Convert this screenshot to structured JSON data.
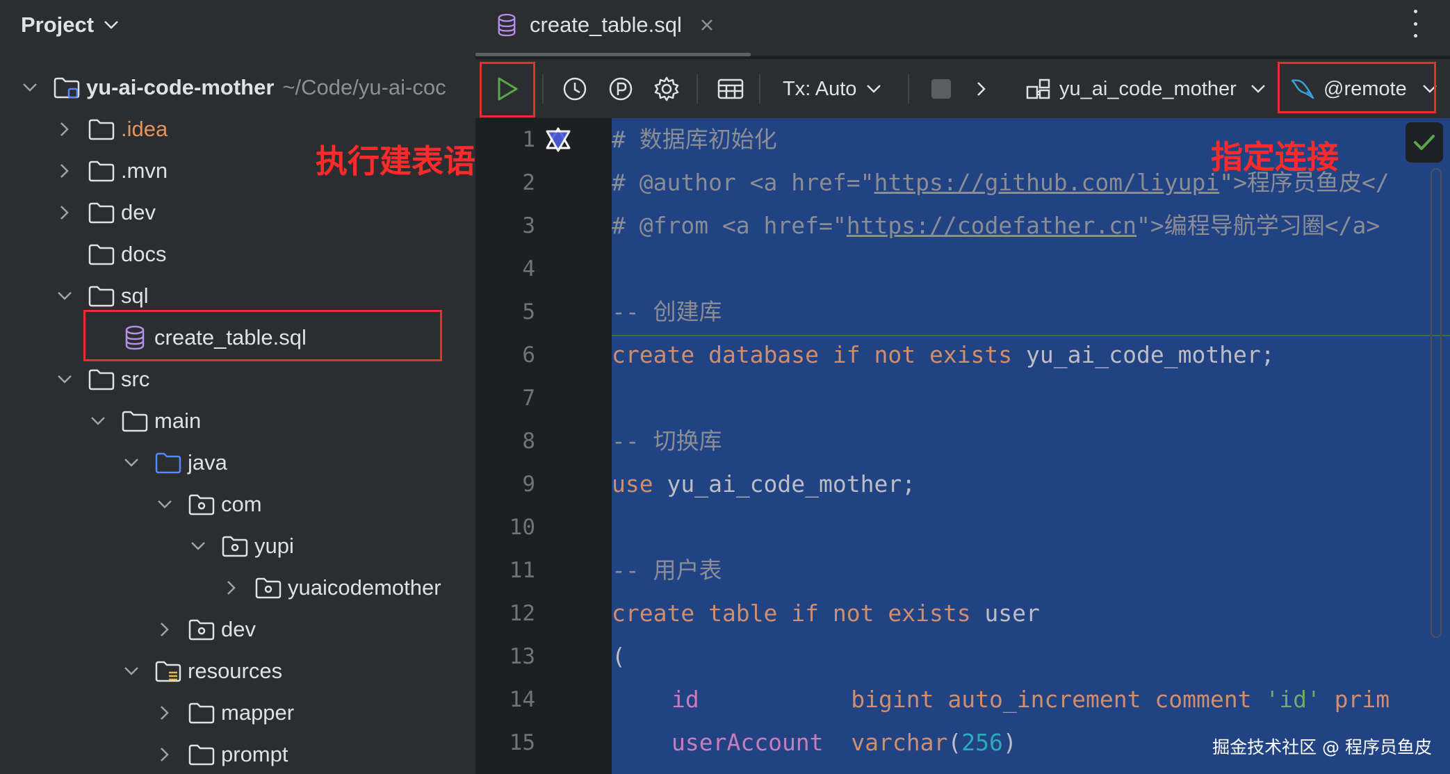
{
  "sidebar": {
    "title": "Project",
    "items": [
      {
        "label": "yu-ai-code-mother",
        "path": "~/Code/yu-ai-coc",
        "expanded": true,
        "kind": "module"
      },
      {
        "label": ".idea",
        "kind": "folder"
      },
      {
        "label": ".mvn",
        "kind": "folder"
      },
      {
        "label": "dev",
        "kind": "folder"
      },
      {
        "label": "docs",
        "kind": "folder"
      },
      {
        "label": "sql",
        "kind": "folder"
      },
      {
        "label": "create_table.sql",
        "kind": "sql-file"
      },
      {
        "label": "src",
        "kind": "folder"
      },
      {
        "label": "main",
        "kind": "folder"
      },
      {
        "label": "java",
        "kind": "source-folder"
      },
      {
        "label": "com",
        "kind": "package"
      },
      {
        "label": "yupi",
        "kind": "package"
      },
      {
        "label": "yuaicodemother",
        "kind": "package"
      },
      {
        "label": "dev",
        "kind": "package"
      },
      {
        "label": "resources",
        "kind": "resources-folder"
      },
      {
        "label": "mapper",
        "kind": "folder"
      },
      {
        "label": "prompt",
        "kind": "folder"
      }
    ]
  },
  "annotations": {
    "run_statement": "执行建表语句",
    "specify_connection": "指定连接"
  },
  "editor": {
    "tab": {
      "label": "create_table.sql"
    },
    "toolbar": {
      "tx_mode": "Tx: Auto",
      "schema": "yu_ai_code_mother",
      "connection": "@remote"
    },
    "line_numbers": [
      "1",
      "2",
      "3",
      "4",
      "5",
      "6",
      "7",
      "8",
      "9",
      "10",
      "11",
      "12",
      "13",
      "14",
      "15"
    ],
    "lines": {
      "l1": "# 数据库初始化",
      "l2_pre": "# @author <a href=\"",
      "l2_url": "https://github.com/liyupi",
      "l2_post": "\">程序员鱼皮</",
      "l3_pre": "# @from <a href=\"",
      "l3_url": "https://codefather.cn",
      "l3_post": "\">编程导航学习圈</a>",
      "l5": "-- 创建库",
      "l6_kw": "create database if not exists",
      "l6_id": " yu_ai_code_mother;",
      "l8": "-- 切换库",
      "l9_kw": "use",
      "l9_id": " yu_ai_code_mother;",
      "l11": "-- 用户表",
      "l12_kw": "create table if not exists",
      "l12_id": " user",
      "l13": "(",
      "l14_col": "id",
      "l14_pad": "           ",
      "l14_kw": "bigint auto_increment comment",
      "l14_str": " 'id'",
      "l14_kw2": " prim",
      "l15_col": "userAccount",
      "l15_pad": "  ",
      "l15_kw": "varchar",
      "l15_p1": "(",
      "l15_num": "256",
      "l15_p2": ")"
    }
  },
  "watermark": "掘金技术社区 @ 程序员鱼皮"
}
